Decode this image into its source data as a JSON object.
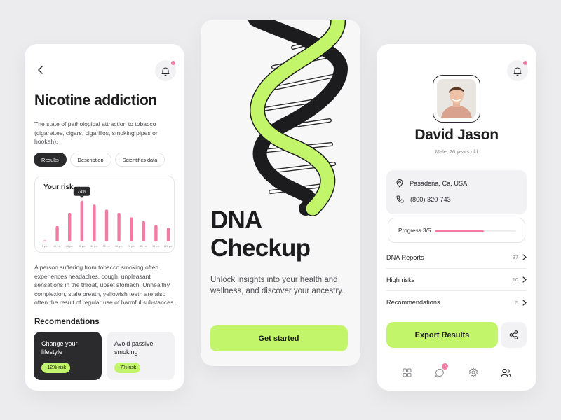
{
  "left": {
    "title": "Nicotine addiction",
    "description": "The state of pathological attraction to tobacco (cigarettes, cigars, cigarillos, smoking pipes or hookah).",
    "tabs": [
      {
        "label": "Results",
        "active": true
      },
      {
        "label": "Description",
        "active": false
      },
      {
        "label": "Scientifics data",
        "active": false
      }
    ],
    "body": "A person suffering from tobacco smoking often experiences headaches, cough, unpleasant sensations in the throat, upset stomach. Unhealthy complexion, stale breath, yellowish teeth are also often the result of regular use of harmful substances.",
    "recommendations_title": "Recomendations",
    "recommendations": [
      {
        "label": "Change your lifestyle",
        "risk": "-12% risk"
      },
      {
        "label": "Avoid passive smoking",
        "risk": "-7% risk"
      }
    ]
  },
  "chart_data": {
    "type": "bar",
    "title": "Your risk",
    "categories": [
      "5 у.о.",
      "15 у.о.",
      "25 у.о.",
      "35 у.о.",
      "45 у.о.",
      "55 у.о.",
      "65 у.о.",
      "75 у.о.",
      "85 у.о.",
      "95 у.о.",
      "100 у.о."
    ],
    "values": [
      2,
      28,
      52,
      74,
      67,
      58,
      52,
      44,
      37,
      30,
      25
    ],
    "highlight_label": "74%",
    "highlight_index": 3,
    "ylim": [
      0,
      80
    ],
    "grid": false,
    "bar_color": "#f27ba3"
  },
  "middle": {
    "title_line1": "DNA",
    "title_line2": "Checkup",
    "subtitle": "Unlock insights into your health and wellness, and discover your ancestry.",
    "cta_label": "Get started"
  },
  "right": {
    "name": "David Jason",
    "meta": "Male, 26 years old",
    "location": "Pasadena, Ca, USA",
    "phone": "(800) 320-743",
    "progress_label": "Progress 3/5",
    "progress_fraction": 0.6,
    "list": [
      {
        "label": "DNA Reports",
        "count": "87"
      },
      {
        "label": "High risks",
        "count": "10"
      },
      {
        "label": "Recommendations",
        "count": "5"
      }
    ],
    "export_label": "Export Results",
    "nav_badge": "2"
  },
  "colors": {
    "accent_green": "#c3f56a",
    "accent_pink": "#f27ba3",
    "dark": "#2a2a2c"
  },
  "icons": [
    "chevron-left-icon",
    "bell-icon",
    "location-pin-icon",
    "phone-icon",
    "chevron-right-icon",
    "share-icon",
    "grid-icon",
    "chat-icon",
    "gear-icon",
    "users-icon"
  ]
}
